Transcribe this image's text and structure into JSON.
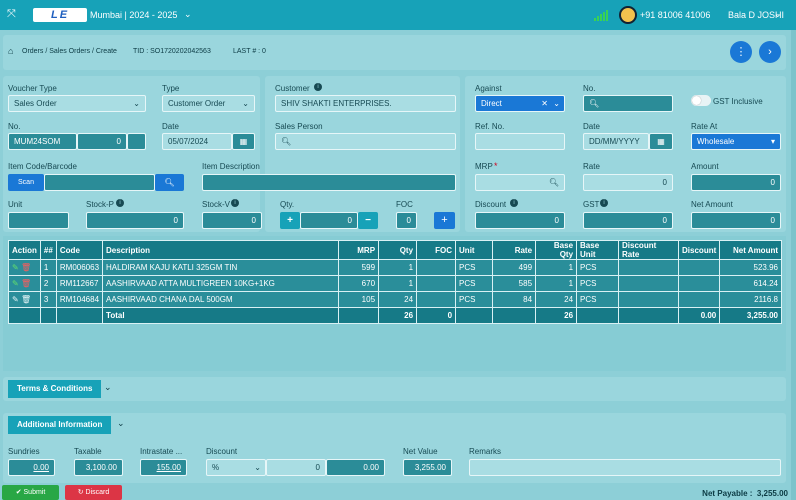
{
  "topbar": {
    "expand_icon": "expand-icon",
    "location": "Mumbai | 2024 - 2025",
    "phone": "+91 81006 41006",
    "user": "Bala D JOSHI"
  },
  "crumb": {
    "path": "Orders / Sales Orders / Create",
    "tid": "TID : SO1720202042563",
    "last": "LAST # : 0"
  },
  "form": {
    "voucher_type_label": "Voucher Type",
    "voucher_type": "Sales Order",
    "type_label": "Type",
    "type": "Customer Order",
    "no_label": "No.",
    "no_prefix": "MUM24SOM",
    "no_value": "0",
    "date_label": "Date",
    "date": "05/07/2024",
    "item_code_label": "Item Code/Barcode",
    "scan_label": "Scan",
    "unit_label": "Unit",
    "stockp_label": "Stock-P",
    "stockp": "0",
    "customer_label": "Customer",
    "customer": "SHIV SHAKTI ENTERPRISES.",
    "salesperson_label": "Sales Person",
    "item_desc_label": "Item Description",
    "stockv_label": "Stock-V",
    "stockv": "0",
    "qty_label": "Qty.",
    "qty": "0",
    "foc_label": "FOC",
    "foc": "0",
    "against_label": "Against",
    "against": "Direct",
    "no2_label": "No.",
    "gst_inclusive": "GST Inclusive",
    "refno_label": "Ref. No.",
    "date2_label": "Date",
    "date2_placeholder": "DD/MM/YYYY",
    "rateat_label": "Rate At",
    "rateat": "Wholesale",
    "mrp_label": "MRP",
    "rate_label": "Rate",
    "rate": "0",
    "amount_label": "Amount",
    "amount": "0",
    "discount_label": "Discount",
    "discount": "0",
    "gst_label": "GST",
    "gst": "0",
    "netamount_label": "Net Amount",
    "netamount": "0"
  },
  "table": {
    "headers": [
      "Action",
      "##",
      "Code",
      "Description",
      "MRP",
      "Qty",
      "FOC",
      "Unit",
      "Rate",
      "Base Qty",
      "Base Unit",
      "Discount Rate",
      "Discount",
      "Net Amount"
    ],
    "rows": [
      {
        "n": "1",
        "code": "RM006063",
        "desc": "HALDIRAM KAJU KATLI 325GM TIN",
        "mrp": "599",
        "qty": "1",
        "foc": "",
        "unit": "PCS",
        "rate": "499",
        "bqty": "1",
        "bunit": "PCS",
        "drate": "",
        "disc": "",
        "net": "523.96"
      },
      {
        "n": "2",
        "code": "RM112667",
        "desc": "AASHIRVAAD ATTA MULTIGREEN 10KG+1KG",
        "mrp": "670",
        "qty": "1",
        "foc": "",
        "unit": "PCS",
        "rate": "585",
        "bqty": "1",
        "bunit": "PCS",
        "drate": "",
        "disc": "",
        "net": "614.24"
      },
      {
        "n": "3",
        "code": "RM104684",
        "desc": "AASHIRVAAD CHANA DAL 500GM",
        "mrp": "105",
        "qty": "24",
        "foc": "",
        "unit": "PCS",
        "rate": "84",
        "bqty": "24",
        "bunit": "PCS",
        "drate": "",
        "disc": "",
        "net": "2116.8"
      }
    ],
    "total_label": "Total",
    "total_qty": "26",
    "total_foc": "0",
    "total_bqty": "26",
    "total_disc": "0.00",
    "total_net": "3,255.00"
  },
  "sections": {
    "terms": "Terms & Conditions",
    "additional": "Additional Information"
  },
  "summary": {
    "sundries_label": "Sundries",
    "sundries": "0.00",
    "taxable_label": "Taxable",
    "taxable": "3,100.00",
    "intrastate_label": "Intrastate ...",
    "intrastate": "155.00",
    "discount_label": "Discount",
    "discount_type": "%",
    "discount_pct": "0",
    "discount_amt": "0.00",
    "netvalue_label": "Net Value",
    "netvalue": "3,255.00",
    "remarks_label": "Remarks"
  },
  "footer": {
    "submit": "Submit",
    "discard": "Discard",
    "net_payable": "Net Payable :  3,255.00"
  },
  "colors": {
    "topbar": "#17a2b8",
    "accent_blue": "#1a78d6",
    "field": "#2b8c98",
    "submit": "#28a745",
    "discard": "#dc3545"
  }
}
